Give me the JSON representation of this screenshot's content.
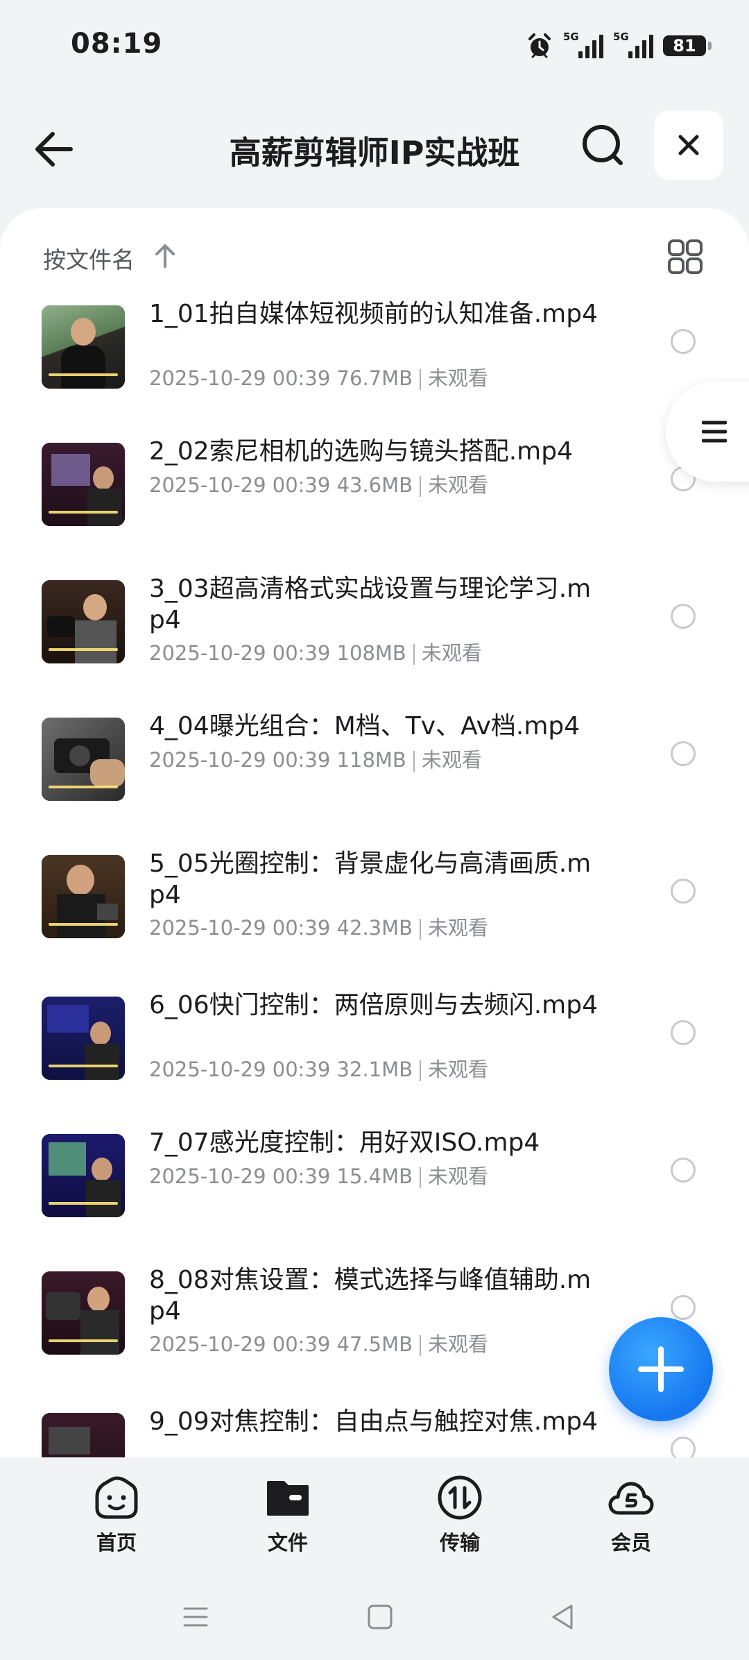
{
  "status_bar": {
    "time": "08:19",
    "signal1": "5G",
    "signal2": "5G",
    "battery": "81"
  },
  "header": {
    "title": "高薪剪辑师IP实战班"
  },
  "toolbar": {
    "sort_label": "按文件名"
  },
  "files": [
    {
      "title": "1_01拍自媒体短视频前的认知准备.mp4",
      "date": "2025-10-29 00:39",
      "size": "76.7MB",
      "status": "未观看"
    },
    {
      "title": "2_02索尼相机的选购与镜头搭配.mp4",
      "date": "2025-10-29 00:39",
      "size": "43.6MB",
      "status": "未观看"
    },
    {
      "title": "3_03超高清格式实战设置与理论学习.mp4",
      "date": "2025-10-29 00:39",
      "size": "108MB",
      "status": "未观看"
    },
    {
      "title": "4_04曝光组合：M档、Tv、Av档.mp4",
      "date": "2025-10-29 00:39",
      "size": "118MB",
      "status": "未观看"
    },
    {
      "title": "5_05光圈控制：背景虚化与高清画质.mp4",
      "date": "2025-10-29 00:39",
      "size": "42.3MB",
      "status": "未观看"
    },
    {
      "title": "6_06快门控制：两倍原则与去频闪.mp4",
      "date": "2025-10-29 00:39",
      "size": "32.1MB",
      "status": "未观看"
    },
    {
      "title": "7_07感光度控制：用好双ISO.mp4",
      "date": "2025-10-29 00:39",
      "size": "15.4MB",
      "status": "未观看"
    },
    {
      "title": "8_08对焦设置：模式选择与峰值辅助.mp4",
      "date": "2025-10-29 00:39",
      "size": "47.5MB",
      "status": "未观看"
    },
    {
      "title": "9_09对焦控制：自由点与触控对焦.mp4",
      "date": "",
      "size": "",
      "status": ""
    }
  ],
  "bottom_nav": [
    {
      "label": "首页",
      "icon": "smile-icon"
    },
    {
      "label": "文件",
      "icon": "folder-icon"
    },
    {
      "label": "传输",
      "icon": "transfer-icon"
    },
    {
      "label": "会员",
      "icon": "cloud-vip-icon"
    }
  ],
  "colors": {
    "accent": "#1677f0",
    "background": "#f2f3f5"
  }
}
